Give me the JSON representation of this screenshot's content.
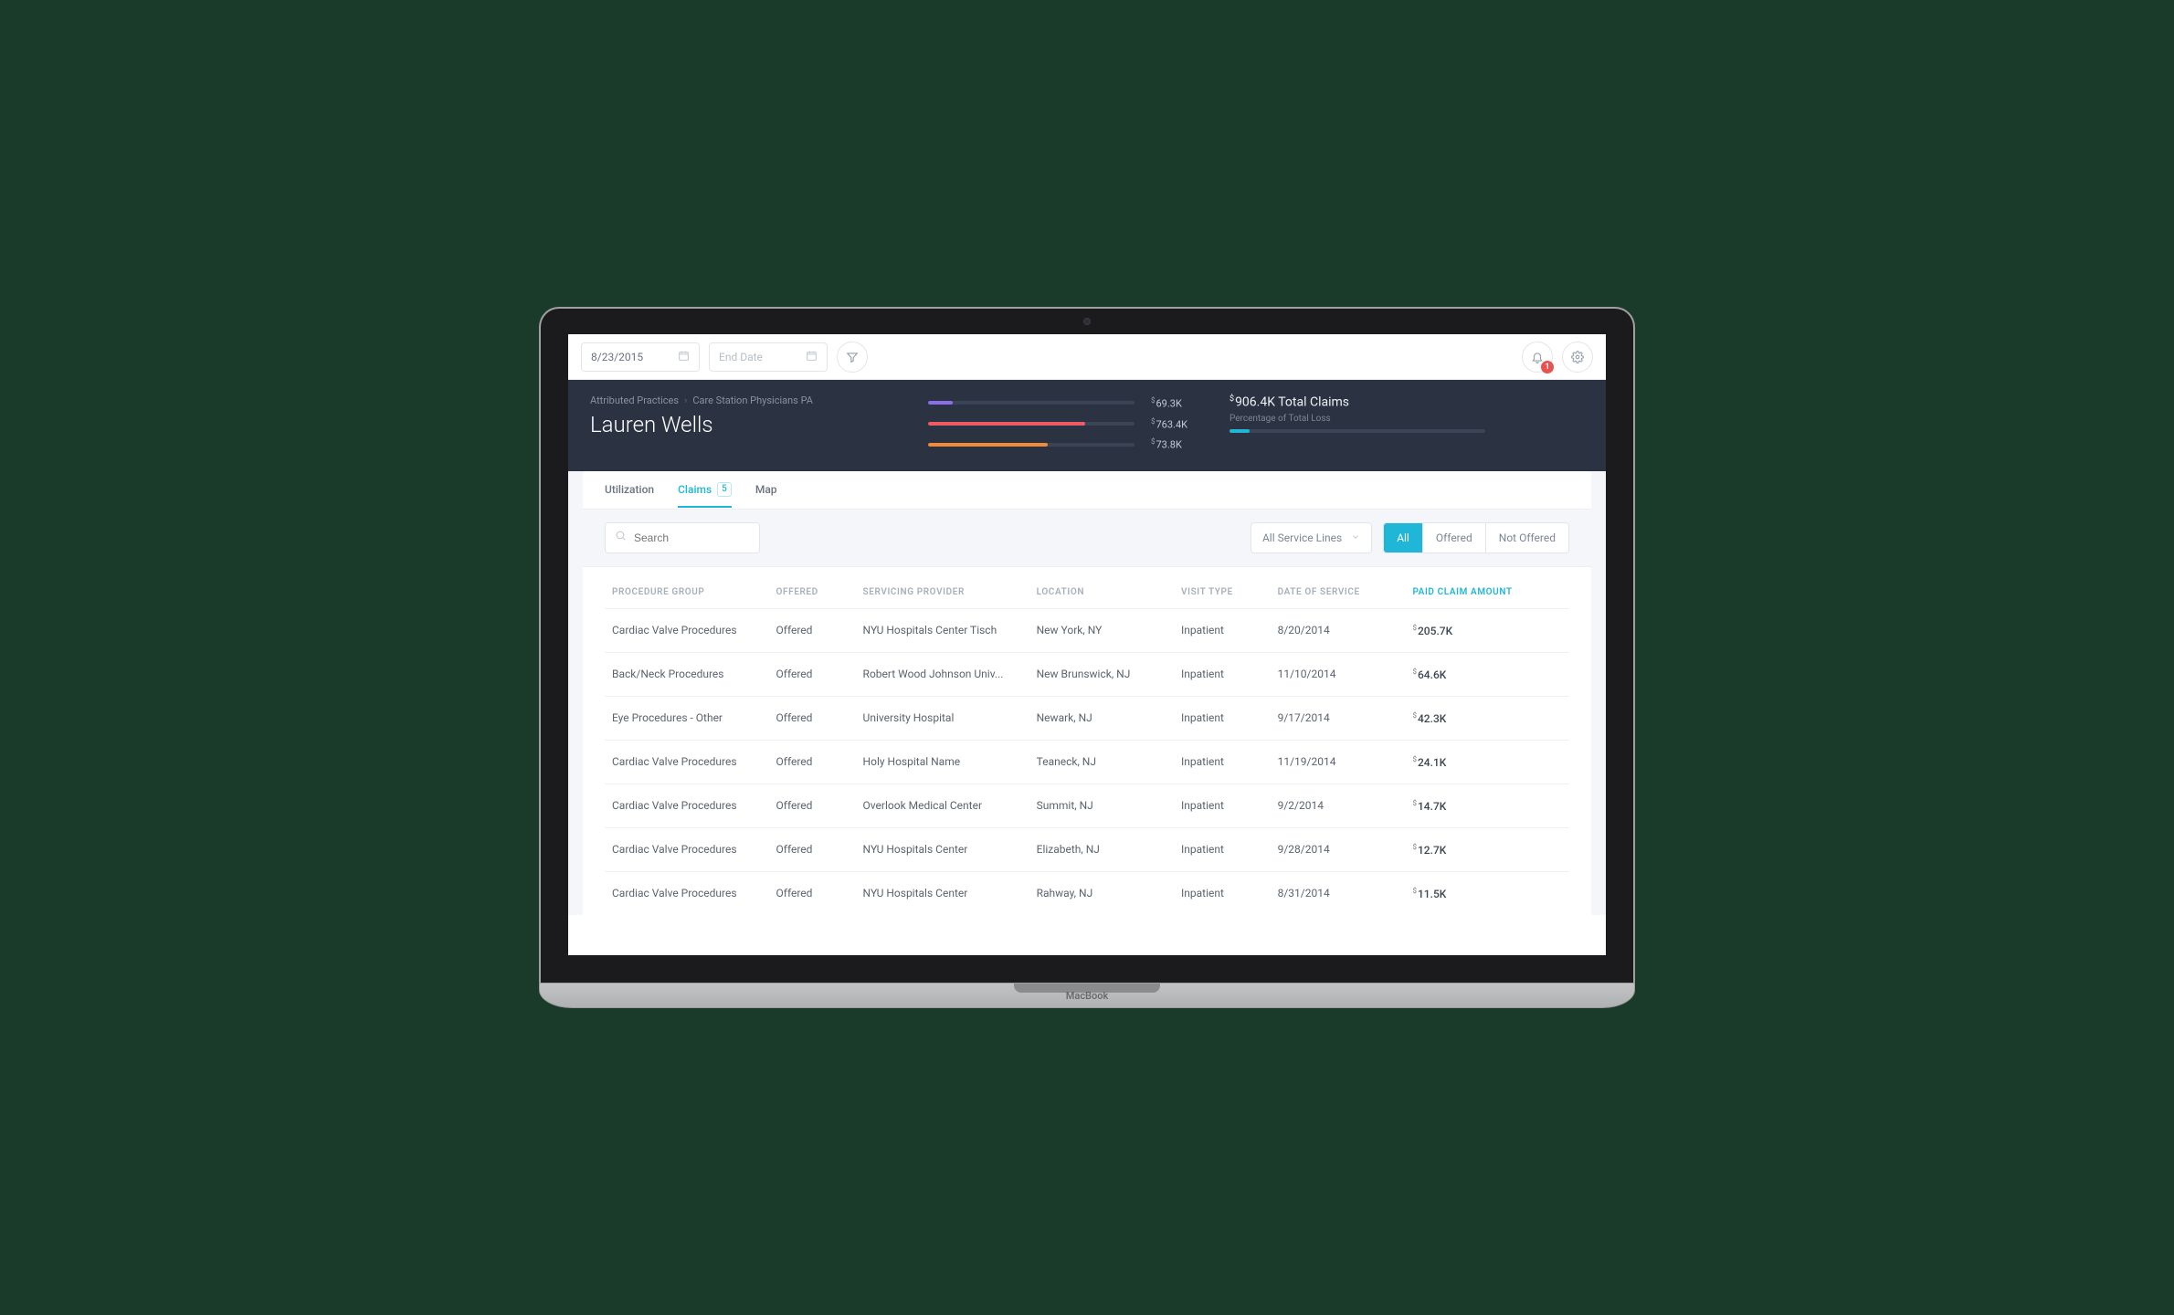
{
  "toolbar": {
    "start_date": "8/23/2015",
    "end_date_placeholder": "End Date",
    "notification_count": "1"
  },
  "breadcrumb": {
    "root": "Attributed Practices",
    "current": "Care Station Physicians PA"
  },
  "patient_name": "Lauren Wells",
  "summary_bars": [
    {
      "value": "69.3K",
      "fill_pct": 12,
      "color": "#8a6fe8"
    },
    {
      "value": "763.4K",
      "fill_pct": 76,
      "color": "#ee5a67"
    },
    {
      "value": "73.8K",
      "fill_pct": 58,
      "color": "#f08b3b"
    }
  ],
  "total_claims": {
    "amount": "906.4K",
    "label_suffix": "Total Claims",
    "subtitle": "Percentage of Total Loss",
    "fill_pct": 8
  },
  "tabs": [
    {
      "label": "Utilization",
      "active": false
    },
    {
      "label": "Claims",
      "count": "5",
      "active": true
    },
    {
      "label": "Map",
      "active": false
    }
  ],
  "search_placeholder": "Search",
  "service_line_filter": "All Service Lines",
  "segments": [
    {
      "label": "All",
      "active": true
    },
    {
      "label": "Offered",
      "active": false
    },
    {
      "label": "Not Offered",
      "active": false
    }
  ],
  "columns": {
    "procedure_group": "Procedure Group",
    "offered": "Offered",
    "servicing_provider": "Servicing Provider",
    "location": "Location",
    "visit_type": "Visit Type",
    "date_of_service": "Date of Service",
    "paid_claim_amount": "Paid Claim Amount"
  },
  "rows": [
    {
      "procedure_group": "Cardiac Valve Procedures",
      "offered": "Offered",
      "provider": "NYU Hospitals Center Tisch",
      "location": "New York, NY",
      "visit": "Inpatient",
      "date": "8/20/2014",
      "amount": "205.7K"
    },
    {
      "procedure_group": "Back/Neck Procedures",
      "offered": "Offered",
      "provider": "Robert Wood Johnson Univ...",
      "location": "New Brunswick, NJ",
      "visit": "Inpatient",
      "date": "11/10/2014",
      "amount": "64.6K"
    },
    {
      "procedure_group": "Eye Procedures - Other",
      "offered": "Offered",
      "provider": "University Hospital",
      "location": "Newark, NJ",
      "visit": "Inpatient",
      "date": "9/17/2014",
      "amount": "42.3K"
    },
    {
      "procedure_group": "Cardiac Valve Procedures",
      "offered": "Offered",
      "provider": "Holy Hospital Name",
      "location": "Teaneck, NJ",
      "visit": "Inpatient",
      "date": "11/19/2014",
      "amount": "24.1K"
    },
    {
      "procedure_group": "Cardiac Valve Procedures",
      "offered": "Offered",
      "provider": "Overlook Medical Center",
      "location": "Summit, NJ",
      "visit": "Inpatient",
      "date": "9/2/2014",
      "amount": "14.7K"
    },
    {
      "procedure_group": "Cardiac Valve Procedures",
      "offered": "Offered",
      "provider": "NYU Hospitals Center",
      "location": "Elizabeth, NJ",
      "visit": "Inpatient",
      "date": "9/28/2014",
      "amount": "12.7K"
    },
    {
      "procedure_group": "Cardiac Valve Procedures",
      "offered": "Offered",
      "provider": "NYU Hospitals Center",
      "location": "Rahway, NJ",
      "visit": "Inpatient",
      "date": "8/31/2014",
      "amount": "11.5K"
    }
  ],
  "device_label": "MacBook"
}
